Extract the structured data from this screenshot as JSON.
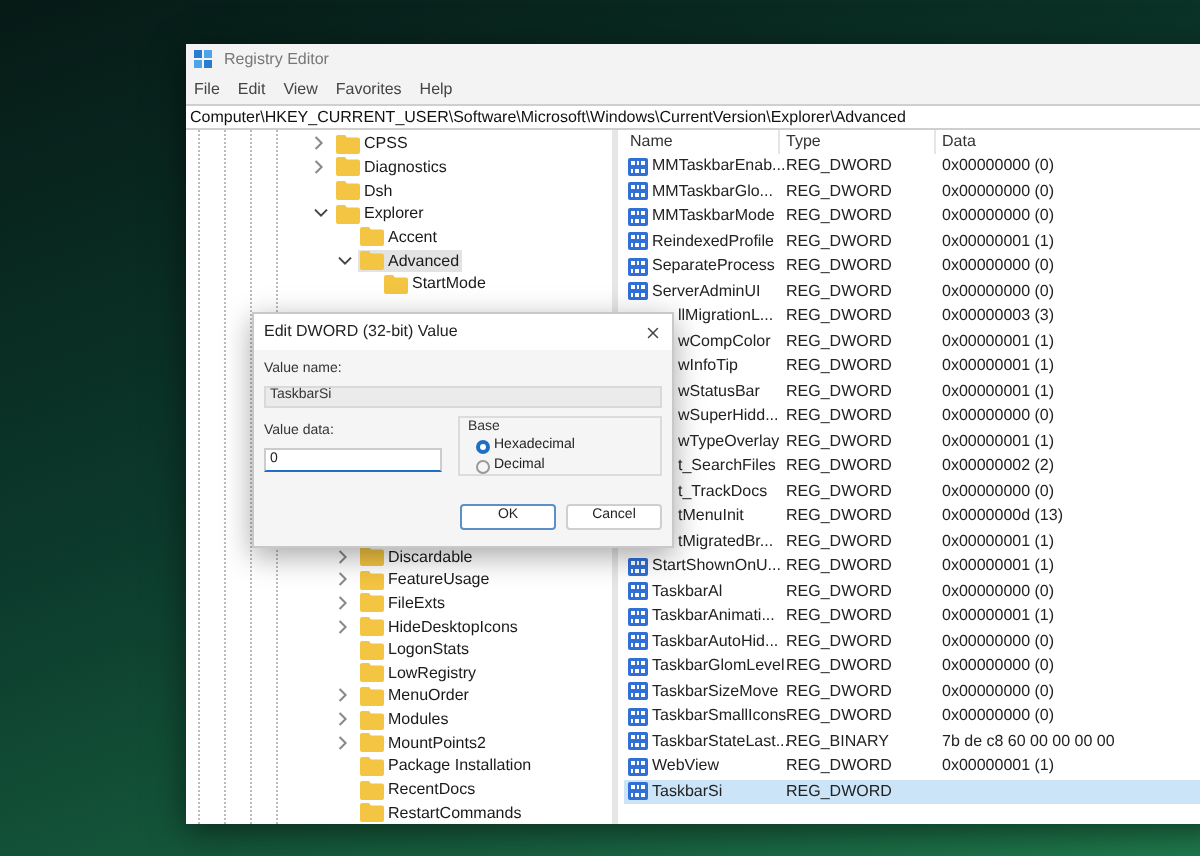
{
  "window": {
    "title": "Registry Editor"
  },
  "menu": [
    "File",
    "Edit",
    "View",
    "Favorites",
    "Help"
  ],
  "address": "Computer\\HKEY_CURRENT_USER\\Software\\Microsoft\\Windows\\CurrentVersion\\Explorer\\Advanced",
  "tree": [
    {
      "label": "CPSS",
      "expanded": false,
      "selected": false
    },
    {
      "label": "Diagnostics",
      "expanded": false,
      "selected": false
    },
    {
      "label": "Dsh",
      "selected": false
    },
    {
      "label": "Explorer",
      "expanded": true,
      "selected": false,
      "children": [
        {
          "label": "Accent",
          "selected": false
        },
        {
          "label": "Advanced",
          "expanded": true,
          "selected": true,
          "children": [
            {
              "label": "StartMode",
              "selected": false
            }
          ]
        },
        {
          "label": "Discardable",
          "expanded": false,
          "selected": false
        },
        {
          "label": "FeatureUsage",
          "expanded": false,
          "selected": false
        },
        {
          "label": "FileExts",
          "expanded": false,
          "selected": false
        },
        {
          "label": "HideDesktopIcons",
          "expanded": false,
          "selected": false
        },
        {
          "label": "LogonStats",
          "selected": false
        },
        {
          "label": "LowRegistry",
          "selected": false
        },
        {
          "label": "MenuOrder",
          "expanded": false,
          "selected": false
        },
        {
          "label": "Modules",
          "expanded": false,
          "selected": false
        },
        {
          "label": "MountPoints2",
          "expanded": false,
          "selected": false
        },
        {
          "label": "Package Installation",
          "selected": false
        },
        {
          "label": "RecentDocs",
          "selected": false
        },
        {
          "label": "RestartCommands",
          "selected": false
        }
      ]
    }
  ],
  "table": {
    "columns": [
      "Name",
      "Type",
      "Data"
    ],
    "rows": [
      {
        "name": "MMTaskbarEnab...",
        "type": "REG_DWORD",
        "data": "0x00000000 (0)",
        "covered": false,
        "selected": false
      },
      {
        "name": "MMTaskbarGlo...",
        "type": "REG_DWORD",
        "data": "0x00000000 (0)",
        "covered": false,
        "selected": false
      },
      {
        "name": "MMTaskbarMode",
        "type": "REG_DWORD",
        "data": "0x00000000 (0)",
        "covered": false,
        "selected": false
      },
      {
        "name": "ReindexedProfile",
        "type": "REG_DWORD",
        "data": "0x00000001 (1)",
        "covered": false,
        "selected": false
      },
      {
        "name": "SeparateProcess",
        "type": "REG_DWORD",
        "data": "0x00000000 (0)",
        "covered": false,
        "selected": false
      },
      {
        "name": "ServerAdminUI",
        "type": "REG_DWORD",
        "data": "0x00000000 (0)",
        "covered": false,
        "selected": false
      },
      {
        "name": "llMigrationL...",
        "type": "REG_DWORD",
        "data": "0x00000003 (3)",
        "covered": true,
        "selected": false
      },
      {
        "name": "wCompColor",
        "type": "REG_DWORD",
        "data": "0x00000001 (1)",
        "covered": true,
        "selected": false
      },
      {
        "name": "wInfoTip",
        "type": "REG_DWORD",
        "data": "0x00000001 (1)",
        "covered": true,
        "selected": false
      },
      {
        "name": "wStatusBar",
        "type": "REG_DWORD",
        "data": "0x00000001 (1)",
        "covered": true,
        "selected": false
      },
      {
        "name": "wSuperHidd...",
        "type": "REG_DWORD",
        "data": "0x00000000 (0)",
        "covered": true,
        "selected": false
      },
      {
        "name": "wTypeOverlay",
        "type": "REG_DWORD",
        "data": "0x00000001 (1)",
        "covered": true,
        "selected": false
      },
      {
        "name": "t_SearchFiles",
        "type": "REG_DWORD",
        "data": "0x00000002 (2)",
        "covered": true,
        "selected": false
      },
      {
        "name": "t_TrackDocs",
        "type": "REG_DWORD",
        "data": "0x00000000 (0)",
        "covered": true,
        "selected": false
      },
      {
        "name": "tMenuInit",
        "type": "REG_DWORD",
        "data": "0x0000000d (13)",
        "covered": true,
        "selected": false
      },
      {
        "name": "tMigratedBr...",
        "type": "REG_DWORD",
        "data": "0x00000001 (1)",
        "covered": true,
        "selected": false
      },
      {
        "name": "StartShownOnU...",
        "type": "REG_DWORD",
        "data": "0x00000001 (1)",
        "covered": false,
        "selected": false
      },
      {
        "name": "TaskbarAl",
        "type": "REG_DWORD",
        "data": "0x00000000 (0)",
        "covered": false,
        "selected": false
      },
      {
        "name": "TaskbarAnimati...",
        "type": "REG_DWORD",
        "data": "0x00000001 (1)",
        "covered": false,
        "selected": false
      },
      {
        "name": "TaskbarAutoHid...",
        "type": "REG_DWORD",
        "data": "0x00000000 (0)",
        "covered": false,
        "selected": false
      },
      {
        "name": "TaskbarGlomLevel",
        "type": "REG_DWORD",
        "data": "0x00000000 (0)",
        "covered": false,
        "selected": false
      },
      {
        "name": "TaskbarSizeMove",
        "type": "REG_DWORD",
        "data": "0x00000000 (0)",
        "covered": false,
        "selected": false
      },
      {
        "name": "TaskbarSmallIcons",
        "type": "REG_DWORD",
        "data": "0x00000000 (0)",
        "covered": false,
        "selected": false
      },
      {
        "name": "TaskbarStateLast...",
        "type": "REG_BINARY",
        "data": "7b de c8 60 00 00 00 00",
        "covered": false,
        "selected": false
      },
      {
        "name": "WebView",
        "type": "REG_DWORD",
        "data": "0x00000001 (1)",
        "covered": false,
        "selected": false
      },
      {
        "name": "TaskbarSi",
        "type": "REG_DWORD",
        "covered": false,
        "selected": true
      }
    ]
  },
  "dialog": {
    "title": "Edit DWORD (32-bit) Value",
    "value_name_label": "Value name:",
    "value_name": "TaskbarSi",
    "value_data_label": "Value data:",
    "value_data": "0",
    "base": {
      "label": "Base",
      "options": [
        {
          "label": "Hexadecimal",
          "selected": true
        },
        {
          "label": "Decimal",
          "selected": false
        }
      ]
    },
    "buttons": [
      {
        "label": "OK",
        "default": true
      },
      {
        "label": "Cancel",
        "default": false
      }
    ]
  }
}
